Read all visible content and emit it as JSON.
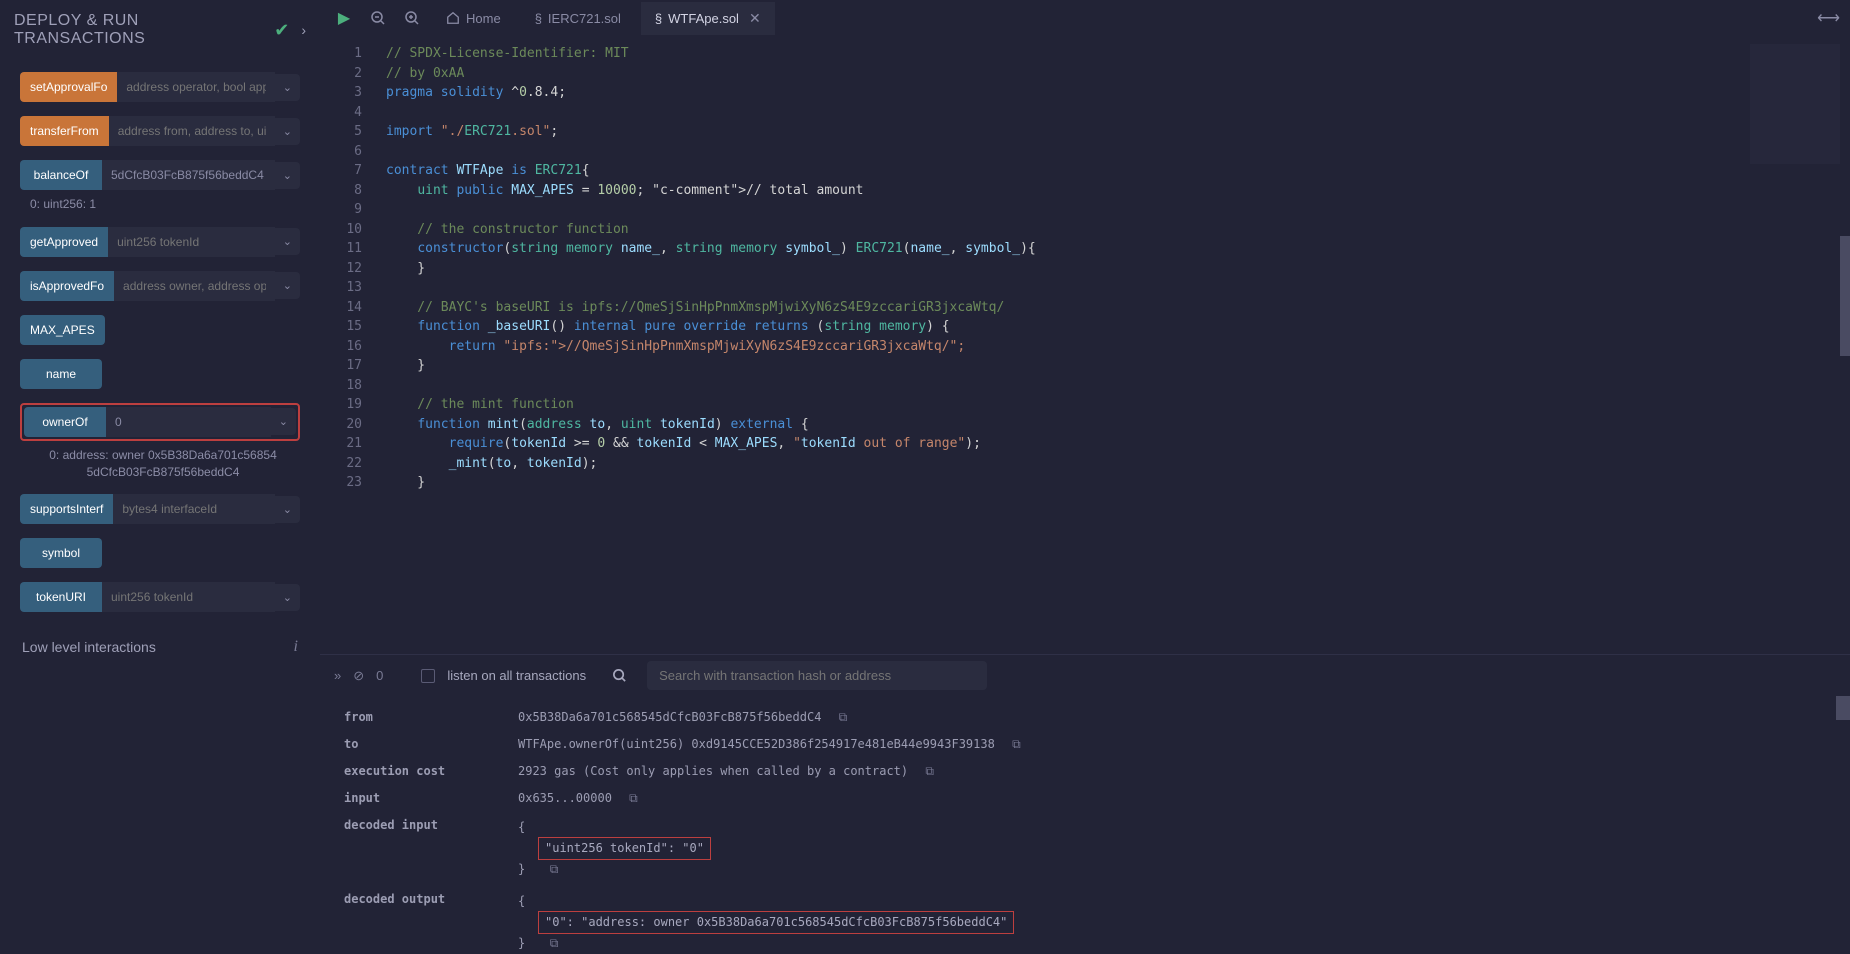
{
  "panel": {
    "title": "DEPLOY & RUN TRANSACTIONS",
    "lowLevel": "Low level interactions"
  },
  "functions": {
    "setApprovalForAll": {
      "label": "setApprovalFo",
      "placeholder": "address operator, bool approv"
    },
    "transferFrom": {
      "label": "transferFrom",
      "placeholder": "address from, address to, uint"
    },
    "balanceOf": {
      "label": "balanceOf",
      "value": "5dCfcB03FcB875f56beddC4",
      "output": "0: uint256: 1"
    },
    "getApproved": {
      "label": "getApproved",
      "placeholder": "uint256 tokenId"
    },
    "isApprovedForAll": {
      "label": "isApprovedFo",
      "placeholder": "address owner, address opera"
    },
    "maxApes": {
      "label": "MAX_APES"
    },
    "name": {
      "label": "name"
    },
    "ownerOf": {
      "label": "ownerOf",
      "value": "0",
      "output": "0: address: owner 0x5B38Da6a701c56854 5dCfcB03FcB875f56beddC4"
    },
    "supportsInterface": {
      "label": "supportsInterf",
      "placeholder": "bytes4 interfaceId"
    },
    "symbol": {
      "label": "symbol"
    },
    "tokenURI": {
      "label": "tokenURI",
      "placeholder": "uint256 tokenId"
    }
  },
  "tabs": {
    "home": "Home",
    "ierc": "IERC721.sol",
    "active": "WTFApe.sol"
  },
  "code": {
    "lines": [
      "// SPDX-License-Identifier: MIT",
      "// by 0xAA",
      "pragma solidity ^0.8.4;",
      "",
      "import \"./ERC721.sol\";",
      "",
      "contract WTFApe is ERC721{",
      "    uint public MAX_APES = 10000; // total amount",
      "",
      "    // the constructor function",
      "    constructor(string memory name_, string memory symbol_) ERC721(name_, symbol_){",
      "    }",
      "",
      "    // BAYC's baseURI is ipfs://QmeSjSinHpPnmXmspMjwiXyN6zS4E9zccariGR3jxcaWtq/",
      "    function _baseURI() internal pure override returns (string memory) {",
      "        return \"ipfs://QmeSjSinHpPnmXmspMjwiXyN6zS4E9zccariGR3jxcaWtq/\";",
      "    }",
      "",
      "    // the mint function",
      "    function mint(address to, uint tokenId) external {",
      "        require(tokenId >= 0 && tokenId < MAX_APES, \"tokenId out of range\");",
      "        _mint(to, tokenId);",
      "    }"
    ]
  },
  "terminal": {
    "listenLabel": "listen on all transactions",
    "searchPlaceholder": "Search with transaction hash or address",
    "zero": "0",
    "rows": {
      "from": {
        "key": "from",
        "val": "0x5B38Da6a701c568545dCfcB03FcB875f56beddC4"
      },
      "to": {
        "key": "to",
        "val": "WTFApe.ownerOf(uint256) 0xd9145CCE52D386f254917e481eB44e9943F39138"
      },
      "cost": {
        "key": "execution cost",
        "val": "2923 gas (Cost only applies when called by a contract)"
      },
      "input": {
        "key": "input",
        "val": "0x635...00000"
      },
      "decodedInput": {
        "key": "decoded input",
        "hl": "\"uint256 tokenId\": \"0\""
      },
      "decodedOutput": {
        "key": "decoded output",
        "hl": "\"0\": \"address: owner 0x5B38Da6a701c568545dCfcB03FcB875f56beddC4\""
      }
    }
  }
}
